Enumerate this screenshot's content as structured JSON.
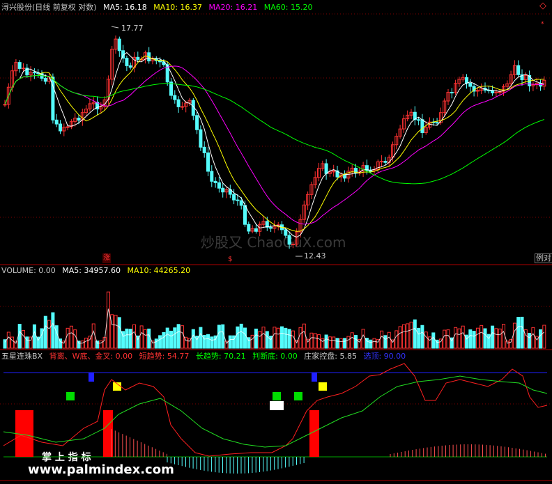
{
  "main_header": {
    "stock": "浔兴股份(日线 前复权 对数)",
    "ma5": "MA5: 16.18",
    "ma10": "MA10: 16.37",
    "ma20": "MA20: 16.21",
    "ma60": "MA60: 15.20"
  },
  "price_labels": {
    "high": "17.77",
    "low": "12.43",
    "zhang_marker": "涨",
    "s_marker": "$",
    "ratio_button": "例对"
  },
  "volume_header": {
    "volume": "VOLUME: 0.00",
    "ma5": "MA5: 34957.60",
    "ma10": "MA10: 44265.20"
  },
  "indicator_header": {
    "name": "五星连珠BX",
    "beili": "背离、W底、金叉: 0.00",
    "short": "短趋势: 54.77",
    "long": "长趋势: 70.21",
    "judge": "判断底: 0.00",
    "zhuang": "庄家控盘: 5.85",
    "select": "选顶: 90.00"
  },
  "watermarks": {
    "center": "炒股又 ChaoGuX.com",
    "bottom_cn": "掌 上 指 标",
    "bottom_url": "www.palmindex.com"
  },
  "colors": {
    "up": "#ff3232",
    "down": "#54fcfc",
    "ma5": "#ffffff",
    "ma10": "#ffff00",
    "ma20": "#ff00ff",
    "ma60": "#00ff00",
    "divider": "#b00000"
  }
}
